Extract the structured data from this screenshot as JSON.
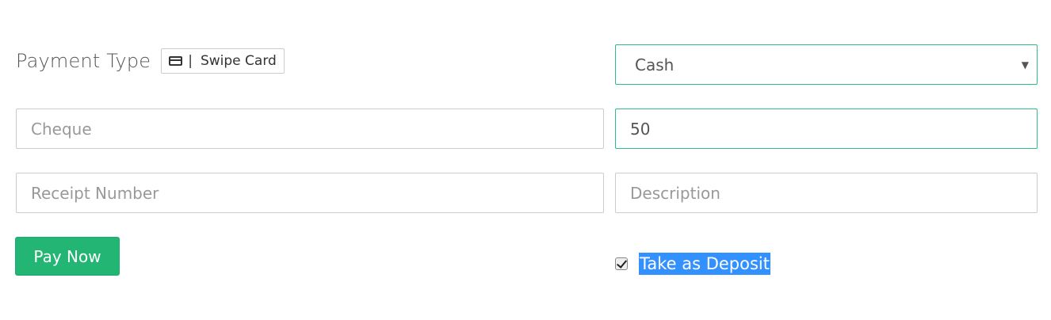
{
  "header": {
    "title": "Payment Type",
    "swipe_card_separator": "|",
    "swipe_card_label": "Swipe Card"
  },
  "payment_method": {
    "selected": "Cash"
  },
  "fields": {
    "cheque": {
      "value": "",
      "placeholder": "Cheque"
    },
    "amount": {
      "value": "50",
      "placeholder": ""
    },
    "receipt_number": {
      "value": "",
      "placeholder": "Receipt Number"
    },
    "description": {
      "value": "",
      "placeholder": "Description"
    }
  },
  "actions": {
    "pay_now_label": "Pay Now"
  },
  "deposit": {
    "checked": true,
    "label": "Take as Deposit"
  },
  "colors": {
    "accent_green": "#22b573",
    "focus_border": "#2bbf82",
    "selection_blue": "#3390ff"
  }
}
